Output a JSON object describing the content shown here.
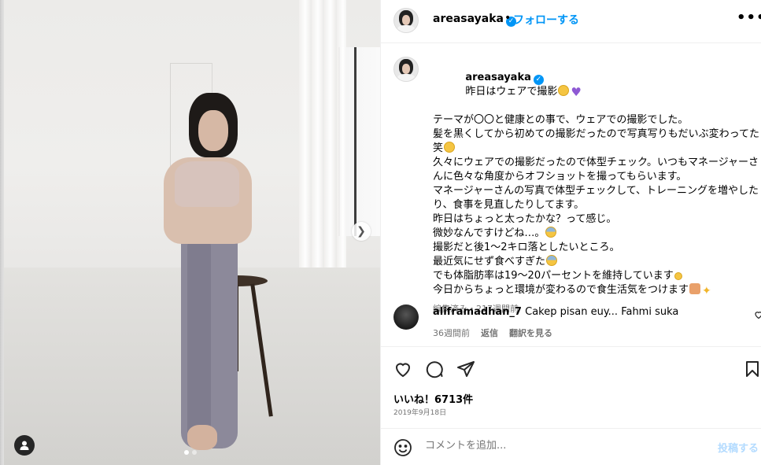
{
  "post": {
    "username": "areasayaka",
    "separator": "•",
    "follow_label": "フォローする",
    "more_label": "•••"
  },
  "caption": {
    "username": "areasayaka",
    "lines": [
      "昨日はウェアで撮影",
      "テーマが〇〇と健康との事で、ウェアでの撮影でした。",
      "髪を黒くしてから初めての撮影だったので写真写りもだいぶ変わってた笑",
      "久々にウェアでの撮影だったので体型チェック。いつもマネージャーさんに色々な角度からオフショットを撮ってもらいます。",
      "マネージャーさんの写真で体型チェックして、トレーニングを増やしたり、食事を見直したりしてます。",
      "昨日はちょっと太ったかな？って感じ。",
      "微妙なんですけどね…。",
      "撮影だと後1〜2キロ落としたいところ。",
      "最近気にせず食べすぎた",
      "でも体脂肪率は19〜20パーセントを維持しています",
      "今日からちょっと環境が変わるので食生活気をつけます"
    ],
    "meta": "編集済み・217週間前"
  },
  "comment": {
    "username": "aliframadhan_7",
    "text": "Cakep pisan euy... Fahmi suka",
    "time": "36週間前",
    "reply_label": "返信",
    "translate_label": "翻訳を見る"
  },
  "engagement": {
    "likes_label": "いいね！6713件",
    "date": "2019年9月18日"
  },
  "add_comment": {
    "placeholder": "コメントを追加...",
    "post_label": "投稿する"
  },
  "icons": {
    "verified": "verified-badge-icon",
    "heart": "heart-icon",
    "comment": "comment-icon",
    "share": "share-icon",
    "save": "bookmark-icon",
    "emoji": "smiley-icon",
    "next": "chevron-right-icon",
    "user_tag": "user-tag-icon"
  },
  "colors": {
    "accent": "#0095f6",
    "muted": "#737373",
    "post_disabled": "#b3dbff"
  }
}
